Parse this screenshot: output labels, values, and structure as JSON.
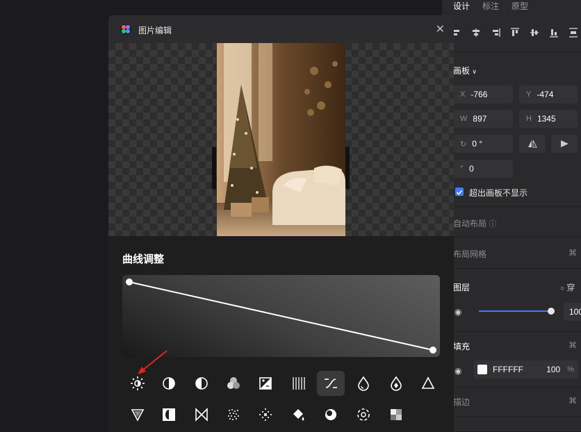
{
  "right_panel": {
    "tabs": [
      "设计",
      "标注",
      "原型"
    ],
    "artboard_label": "画板",
    "x_label": "X",
    "x_value": "-766",
    "y_label": "Y",
    "y_value": "-474",
    "w_label": "W",
    "w_value": "897",
    "h_label": "H",
    "h_value": "1345",
    "rotation": "0 °",
    "radius": "0",
    "clip_label": "超出画板不显示",
    "auto_layout": "自动布局",
    "layout_grid": "布局网格",
    "layers": "图层",
    "layer_blend": "穿",
    "layer_opacity": "100",
    "fill": "填充",
    "fill_hex": "FFFFFF",
    "fill_opacity": "100",
    "fill_unit": "%",
    "stroke": "描边",
    "hash_icon": "⌘"
  },
  "dialog": {
    "title": "图片编辑",
    "close": "✕",
    "section_title": "曲线调整"
  },
  "curve": {
    "points": [
      [
        0,
        1
      ],
      [
        1,
        0
      ]
    ]
  },
  "tools": [
    {
      "name": "brightness-icon"
    },
    {
      "name": "contrast-icon"
    },
    {
      "name": "exposure-icon"
    },
    {
      "name": "color-mix-icon"
    },
    {
      "name": "highlight-shadow-icon"
    },
    {
      "name": "texture-icon"
    },
    {
      "name": "curves-icon",
      "active": true
    },
    {
      "name": "saturation-icon"
    },
    {
      "name": "vibrance-icon"
    },
    {
      "name": "triangle-up-icon"
    },
    {
      "name": "triangle-down-icon"
    },
    {
      "name": "vignette-icon"
    },
    {
      "name": "split-tone-icon"
    },
    {
      "name": "noise-icon"
    },
    {
      "name": "sparkle-icon"
    },
    {
      "name": "fill-bucket-icon"
    },
    {
      "name": "tint-icon"
    },
    {
      "name": "rotate-dashed-icon"
    },
    {
      "name": "mosaic-icon"
    }
  ],
  "colors": {
    "accent": "#3d7bff",
    "dialog_bg": "#131313",
    "panel_bg": "#2a2a2c"
  }
}
